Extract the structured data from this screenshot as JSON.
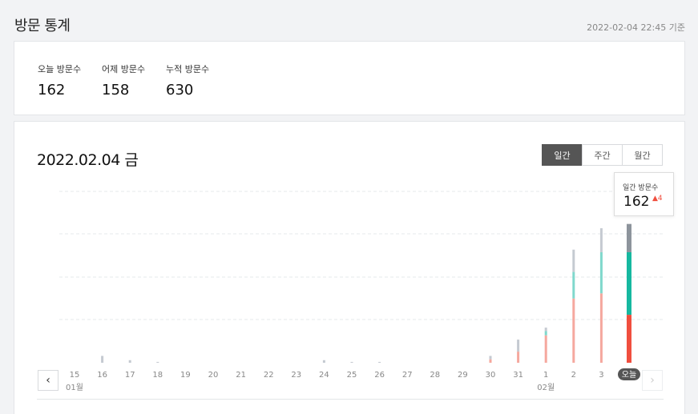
{
  "page": {
    "title": "방문 통계",
    "timestamp": "2022-02-04 22:45 기준"
  },
  "summary": [
    {
      "label": "오늘 방문수",
      "value": "162"
    },
    {
      "label": "어제 방문수",
      "value": "158"
    },
    {
      "label": "누적 방문수",
      "value": "630"
    }
  ],
  "chart_header": {
    "date": "2022.02.04 금",
    "tabs": [
      "일간",
      "주간",
      "월간"
    ],
    "active_tab": 0
  },
  "tooltip": {
    "title": "일간 방문수",
    "value": "162",
    "diff": "▲4"
  },
  "colors": {
    "segment_top": "#c5cad1",
    "segment_mid": "#80d8cc",
    "segment_bottom": "#f5a89e",
    "segment_top_selected": "#8d949c",
    "segment_mid_selected": "#16b8a0",
    "segment_bottom_selected": "#f04e3e",
    "today_badge_bg": "#555555",
    "diff_up": "#f04e3e"
  },
  "icons": {
    "prev": "chevron-left-icon",
    "next": "chevron-right-icon"
  },
  "chart_data": {
    "type": "bar",
    "stacked": true,
    "x_labels": [
      "15",
      "16",
      "17",
      "18",
      "19",
      "20",
      "21",
      "22",
      "23",
      "24",
      "25",
      "26",
      "27",
      "28",
      "29",
      "30",
      "31",
      "1",
      "2",
      "3",
      "오늘"
    ],
    "month_labels": [
      {
        "index": 0,
        "label": "01월"
      },
      {
        "index": 17,
        "label": "02월"
      }
    ],
    "selected_index": 20,
    "series": [
      {
        "values": [
          0,
          0,
          0,
          0,
          0,
          0,
          0,
          0,
          0,
          0,
          0,
          0,
          0,
          0,
          0,
          4,
          13,
          32,
          75,
          81,
          56
        ]
      },
      {
        "values": [
          0,
          0,
          0,
          0,
          0,
          0,
          0,
          0,
          0,
          0,
          0,
          0,
          0,
          0,
          0,
          0,
          0,
          5,
          31,
          48,
          73
        ]
      },
      {
        "values": [
          0,
          8,
          3,
          1,
          0,
          0,
          0,
          0,
          0,
          3,
          1,
          1,
          0,
          0,
          0,
          4,
          14,
          4,
          26,
          28,
          33
        ]
      }
    ],
    "ylim": [
      0,
      200
    ],
    "grid": true,
    "legend": "none"
  }
}
